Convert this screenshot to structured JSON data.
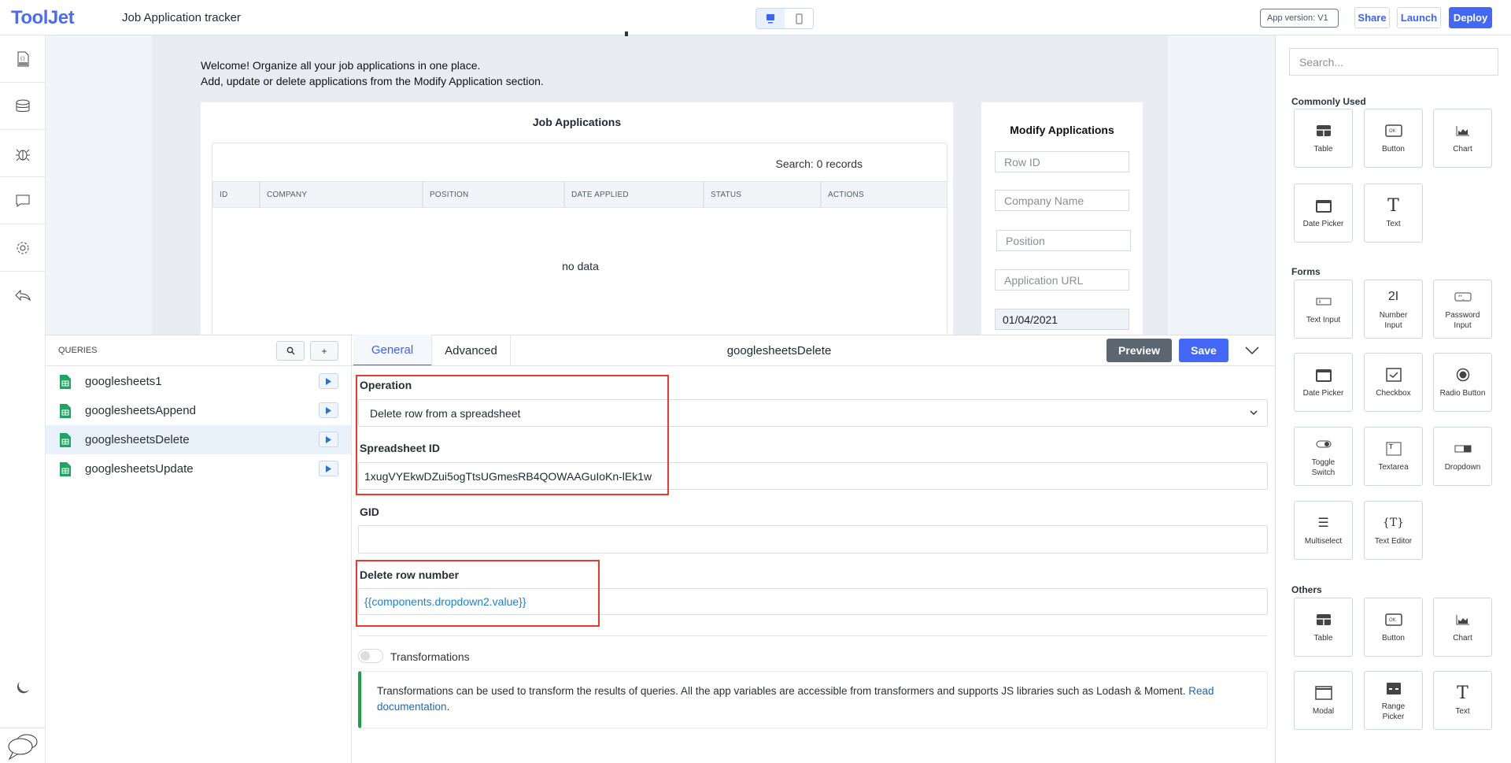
{
  "header": {
    "logo": "ToolJet",
    "app_title": "Job Application tracker",
    "version": "App version: V1",
    "share": "Share",
    "launch": "Launch",
    "deploy": "Deploy"
  },
  "colors": {
    "brand": "#4a6cf7",
    "deploy": "#4368f6",
    "save": "#4368f6",
    "preview": "#5c6670",
    "highlight": "#ea3a2f",
    "info_border": "#1f9e4a",
    "link": "#1e64c8"
  },
  "canvas": {
    "welcome_line1": "Welcome! Organize all your job applications in one place.",
    "welcome_line2": "Add, update or delete applications from the Modify Application section.",
    "table": {
      "title": "Job Applications",
      "search_label": "Search:",
      "records": "0 records",
      "columns": [
        "ID",
        "COMPANY",
        "POSITION",
        "DATE APPLIED",
        "STATUS",
        "ACTIONS"
      ],
      "empty": "no data"
    },
    "modify": {
      "title": "Modify Applications",
      "row_id": "Row ID",
      "company": "Company Name",
      "position": "Position",
      "url": "Application URL",
      "date": "01/04/2021"
    }
  },
  "queries": {
    "title": "QUERIES",
    "items": [
      {
        "name": "googlesheets1"
      },
      {
        "name": "googlesheetsAppend"
      },
      {
        "name": "googlesheetsDelete",
        "selected": true
      },
      {
        "name": "googlesheetsUpdate"
      }
    ]
  },
  "editor": {
    "tabs": [
      "General",
      "Advanced"
    ],
    "query_name": "googlesheetsDelete",
    "preview": "Preview",
    "save": "Save",
    "operation_label": "Operation",
    "operation_value": "Delete row from a spreadsheet",
    "spreadsheet_label": "Spreadsheet ID",
    "spreadsheet_value": "1xugVYEkwDZui5ogTtsUGmesRB4QOWAAGuIoKn-lEk1w",
    "gid_label": "GID",
    "gid_value": "",
    "row_label": "Delete row number",
    "row_value": "{{components.dropdown2.value}}",
    "transformations": "Transformations",
    "info": "Transformations can be used to transform the results of queries. All the app variables are accessible from transformers and supports JS libraries such as Lodash & Moment.",
    "info_link": "Read documentation",
    "info_end": "."
  },
  "widgets": {
    "search_placeholder": "Search...",
    "sections": [
      {
        "title": "Commonly Used",
        "items": [
          {
            "label": "Table",
            "icon": "table"
          },
          {
            "label": "Button",
            "icon": "button"
          },
          {
            "label": "Chart",
            "icon": "chart"
          },
          {
            "label": "Date Picker",
            "icon": "calendar"
          },
          {
            "label": "Text",
            "icon": "text"
          }
        ]
      },
      {
        "title": "Forms",
        "items": [
          {
            "label": "Text Input",
            "icon": "textinput"
          },
          {
            "label": "Number Input",
            "icon": "number"
          },
          {
            "label": "Password Input",
            "icon": "password"
          },
          {
            "label": "Date Picker",
            "icon": "calendar"
          },
          {
            "label": "Checkbox",
            "icon": "checkbox"
          },
          {
            "label": "Radio Button",
            "icon": "radio"
          },
          {
            "label": "Toggle Switch",
            "icon": "toggle"
          },
          {
            "label": "Textarea",
            "icon": "textarea"
          },
          {
            "label": "Dropdown",
            "icon": "dropdown"
          },
          {
            "label": "Multiselect",
            "icon": "multiselect"
          },
          {
            "label": "Text Editor",
            "icon": "texteditor"
          }
        ]
      },
      {
        "title": "Others",
        "items": [
          {
            "label": "Table",
            "icon": "table"
          },
          {
            "label": "Button",
            "icon": "button"
          },
          {
            "label": "Chart",
            "icon": "chart"
          },
          {
            "label": "Modal",
            "icon": "modal"
          },
          {
            "label": "Range Picker",
            "icon": "range"
          },
          {
            "label": "Text",
            "icon": "text"
          }
        ]
      }
    ]
  }
}
